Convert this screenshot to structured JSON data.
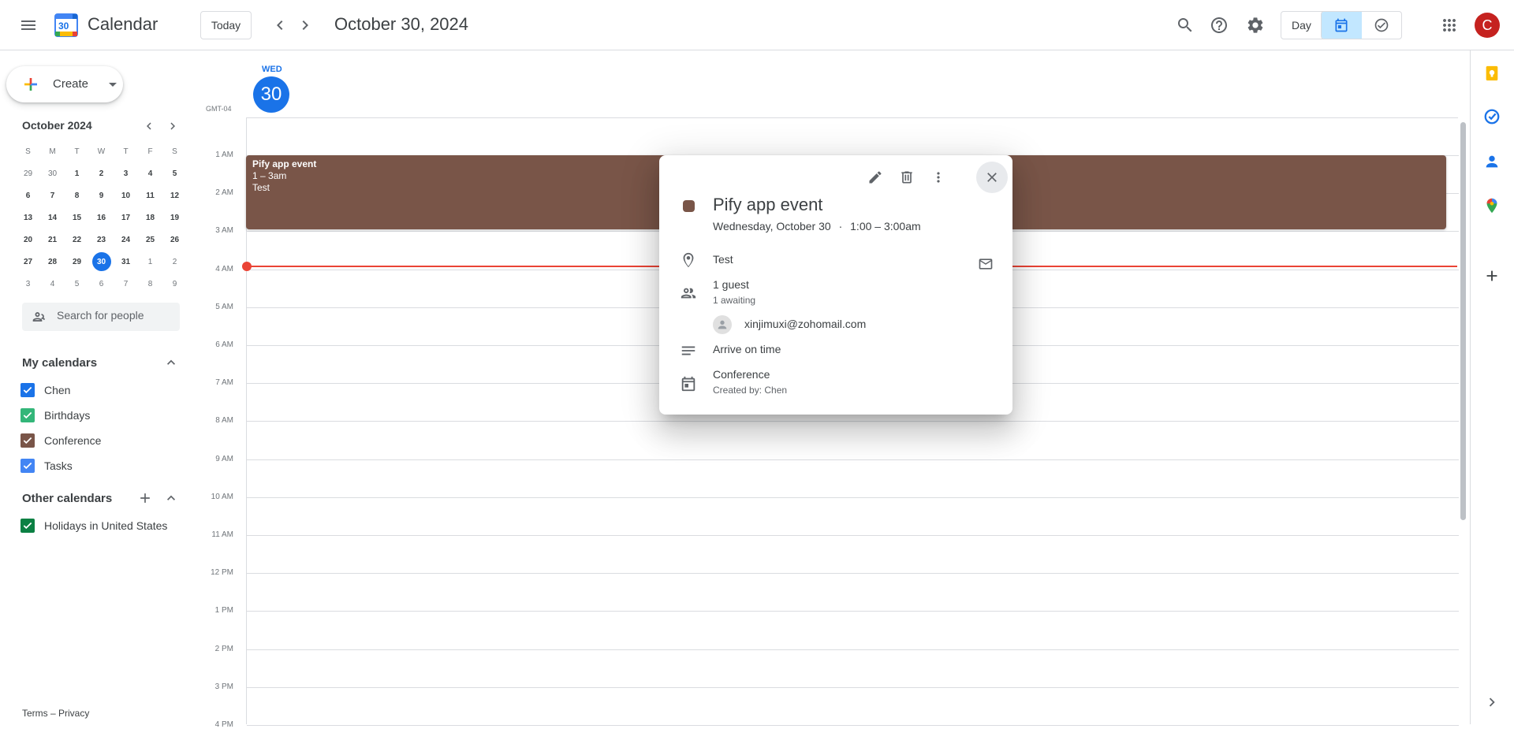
{
  "header": {
    "app_name": "Calendar",
    "logo_day": "30",
    "today_label": "Today",
    "date_title": "October 30, 2024",
    "view_label": "Day",
    "avatar_letter": "C"
  },
  "sidebar": {
    "create_label": "Create",
    "mini_calendar": {
      "title": "October 2024",
      "days_of_week": [
        "S",
        "M",
        "T",
        "W",
        "T",
        "F",
        "S"
      ],
      "weeks": [
        [
          "29",
          "30",
          "1",
          "2",
          "3",
          "4",
          "5"
        ],
        [
          "6",
          "7",
          "8",
          "9",
          "10",
          "11",
          "12"
        ],
        [
          "13",
          "14",
          "15",
          "16",
          "17",
          "18",
          "19"
        ],
        [
          "20",
          "21",
          "22",
          "23",
          "24",
          "25",
          "26"
        ],
        [
          "27",
          "28",
          "29",
          "30",
          "31",
          "1",
          "2"
        ],
        [
          "3",
          "4",
          "5",
          "6",
          "7",
          "8",
          "9"
        ]
      ],
      "today": "30"
    },
    "people_search_placeholder": "Search for people",
    "my_calendars_title": "My calendars",
    "my_calendars": [
      {
        "label": "Chen",
        "color": "#1a73e8"
      },
      {
        "label": "Birthdays",
        "color": "#33b679"
      },
      {
        "label": "Conference",
        "color": "#795548"
      },
      {
        "label": "Tasks",
        "color": "#4285f4"
      }
    ],
    "other_calendars_title": "Other calendars",
    "other_calendars": [
      {
        "label": "Holidays in United States",
        "color": "#0b8043"
      }
    ],
    "footer": "Terms – Privacy"
  },
  "day_view": {
    "day_of_week": "WED",
    "day_number": "30",
    "timezone": "GMT-04",
    "hours": [
      "1 AM",
      "2 AM",
      "3 AM",
      "4 AM",
      "5 AM",
      "6 AM",
      "7 AM",
      "8 AM",
      "9 AM",
      "10 AM",
      "11 AM",
      "12 PM",
      "1 PM",
      "2 PM",
      "3 PM",
      "4 PM"
    ],
    "event": {
      "title": "Pify app event",
      "time": "1 – 3am",
      "location": "Test",
      "color": "#795548"
    }
  },
  "popover": {
    "title": "Pify app event",
    "date": "Wednesday, October 30",
    "separator": "·",
    "time": "1:00 – 3:00am",
    "location": "Test",
    "guests_count": "1 guest",
    "guests_status": "1 awaiting",
    "guest_email": "xinjimuxi@zohomail.com",
    "description": "Arrive on time",
    "calendar_name": "Conference",
    "created_by": "Created by: Chen",
    "color": "#795548"
  }
}
